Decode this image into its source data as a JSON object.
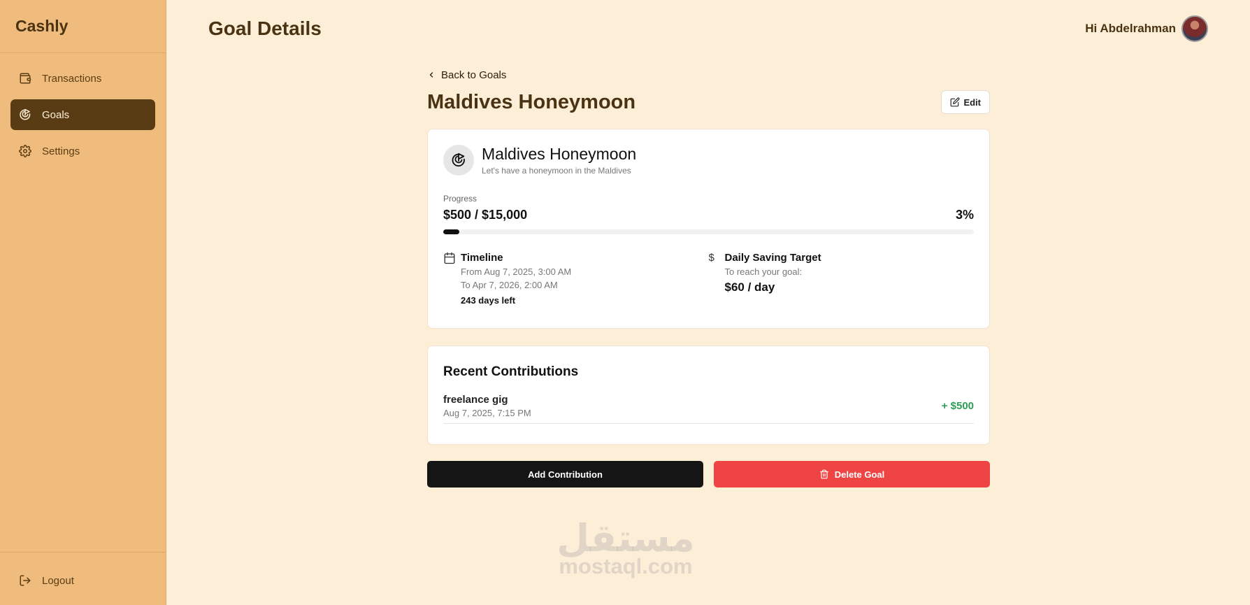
{
  "app": {
    "name": "Cashly"
  },
  "sidebar": {
    "items": [
      {
        "label": "Transactions",
        "icon": "wallet-icon",
        "active": false
      },
      {
        "label": "Goals",
        "icon": "target-icon",
        "active": true
      },
      {
        "label": "Settings",
        "icon": "gear-icon",
        "active": false
      }
    ],
    "logout_label": "Logout"
  },
  "header": {
    "title": "Goal Details",
    "greeting": "Hi Abdelrahman"
  },
  "main": {
    "back_label": "Back to Goals",
    "goal_title": "Maldives Honeymoon",
    "edit_label": "Edit",
    "goal_card": {
      "name": "Maldives Honeymoon",
      "description": "Let's have a honeymoon in the Maldives",
      "progress_label": "Progress",
      "progress_amount": "$500 / $15,000",
      "progress_percent": "3%",
      "progress_fraction": 0.03,
      "timeline": {
        "title": "Timeline",
        "from": "From Aug 7, 2025, 3:00 AM",
        "to": "To Apr 7, 2026, 2:00 AM",
        "days_left": "243 days left"
      },
      "daily": {
        "symbol": "$",
        "title": "Daily Saving Target",
        "subtitle": "To reach your goal:",
        "amount": "$60 / day"
      }
    },
    "contributions": {
      "title": "Recent Contributions",
      "items": [
        {
          "name": "freelance gig",
          "date": "Aug 7, 2025, 7:15 PM",
          "amount": "+ $500"
        }
      ]
    },
    "actions": {
      "add_label": "Add Contribution",
      "delete_label": "Delete Goal"
    }
  },
  "watermark": {
    "arabic": "مستقل",
    "latin": "mostaql.com"
  },
  "colors": {
    "sidebar_bg": "#f0bc7d",
    "page_bg": "#fdeed8",
    "active_nav": "#5a3c14",
    "brown_text": "#4a3312",
    "positive": "#2f9e56",
    "danger": "#ef4444"
  }
}
